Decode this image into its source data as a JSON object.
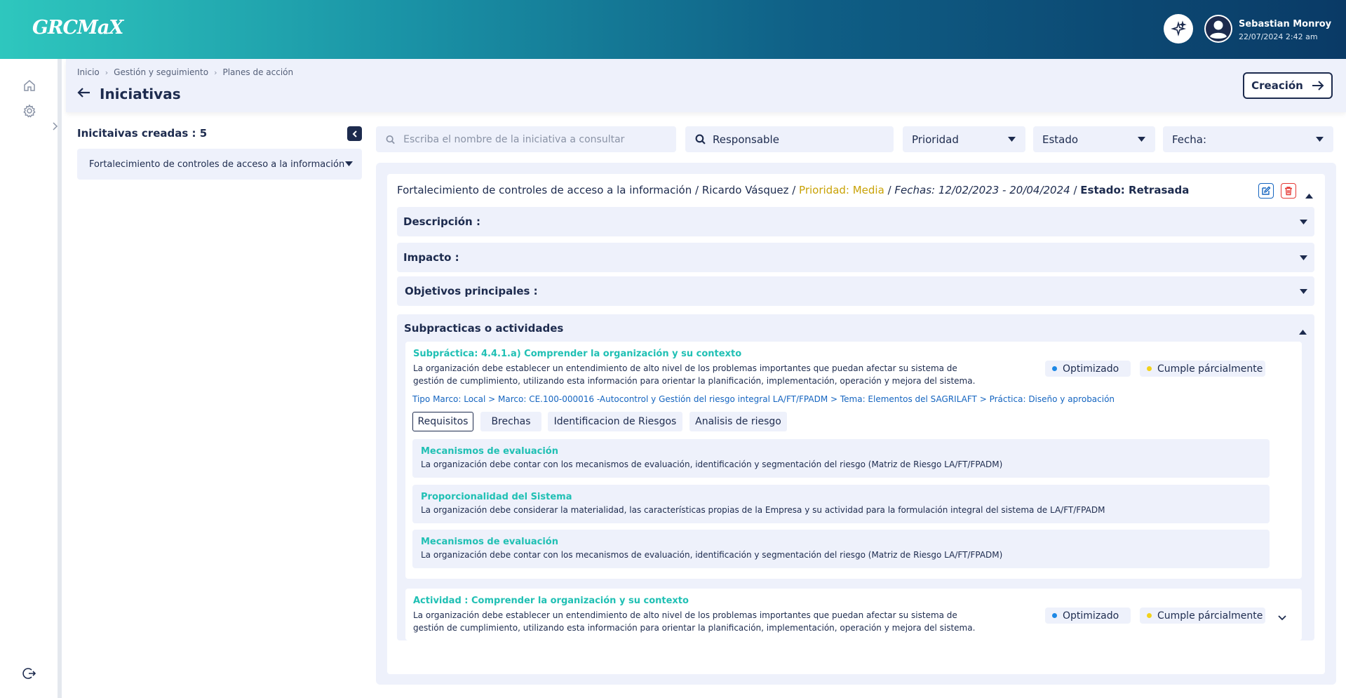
{
  "app": {
    "logo": "GRCMaX"
  },
  "user": {
    "name": "Sebastian Monroy",
    "datetime": "22/07/2024 2:42 am"
  },
  "breadcrumb": [
    "Inicio",
    "Gestión y seguimiento",
    "Planes de acción"
  ],
  "page": {
    "title": "Iniciativas",
    "create_label": "Creación"
  },
  "left_panel": {
    "title": "Inicitaivas creadas : 5",
    "items": [
      {
        "label": "Fortalecimiento de controles de acceso a la información"
      }
    ]
  },
  "filters": {
    "search_placeholder": "Escriba el nombre de la iniciativa a consultar",
    "responsable": "Responsable",
    "prioridad": "Prioridad",
    "estado": "Estado",
    "fecha": "Fecha:"
  },
  "initiative": {
    "name": "Fortalecimiento de controles de acceso a la información",
    "sep1": " / ",
    "owner": "Ricardo Vásquez",
    "sep2": " / ",
    "priority": "Prioridad: Media",
    "sep3": " / ",
    "dates": "Fechas: 12/02/2023 - 20/04/2024",
    "sep4": " / ",
    "status": "Estado: Retrasada"
  },
  "sections": {
    "descripcion": "Descripción :",
    "impacto": "Impacto :",
    "objetivos": "Objetivos principales :",
    "subpracticas": "Subpracticas o actividades"
  },
  "subpractica": {
    "title": "Subpráctica: 4.4.1.a) Comprender la organización y su contexto",
    "desc_line1": "La organización debe establecer un entendimiento de alto nivel de los problemas importantes que puedan afectar su sistema de",
    "desc_line2": "gestión de cumplimiento, utilizando esta información para orientar la planificación, implementación, operación y mejora del sistema.",
    "badge_optimizado": "Optimizado",
    "badge_cumple": "Cumple párcialmente",
    "path": "Tipo Marco: Local > Marco: CE.100-000016 -Autocontrol y Gestión del riesgo integral LA/FT/FPADM > Tema: Elementos del SAGRILAFT > Práctica: Diseño y aprobación",
    "tabs": [
      "Requisitos",
      "Brechas",
      "Identificacion de Riesgos",
      "Analisis de riesgo"
    ],
    "requirements": [
      {
        "title": "Mecanismos de evaluación",
        "desc": "La organización debe contar con los mecanismos de evaluación, identificación y segmentación del riesgo (Matriz de Riesgo LA/FT/FPADM)"
      },
      {
        "title": "Proporcionalidad del Sistema",
        "desc": "La organización debe considerar la materialidad, las características propias de la Empresa y su actividad para la formulación integral del sistema de LA/FT/FPADM"
      },
      {
        "title": "Mecanismos de evaluación",
        "desc": "La organización debe contar con los mecanismos de evaluación, identificación y segmentación del riesgo (Matriz de Riesgo LA/FT/FPADM)"
      }
    ]
  },
  "actividad": {
    "title": "Actividad :  Comprender la organización y su contexto",
    "desc_line1": "La organización debe establecer un entendimiento de alto nivel de los problemas importantes que puedan afectar su sistema de",
    "desc_line2": "gestión de cumplimiento, utilizando esta información para orientar la planificación, implementación, operación y mejora del sistema.",
    "badge_optimizado": "Optimizado",
    "badge_cumple": "Cumple párcialmente"
  },
  "colors": {
    "primary": "#1d2b4e",
    "teal": "#20c0b4",
    "priority": "#c9a206",
    "optimizado_dot": "#1e88e5",
    "cumple_dot": "#f2d21b",
    "delete": "#e53935",
    "edit": "#1565c0"
  },
  "icons": [
    "ai-sparkle-icon",
    "user-avatar-icon",
    "home-icon",
    "gear-icon",
    "logout-icon",
    "back-arrow-icon",
    "arrow-right-icon",
    "search-icon",
    "caret-down-icon",
    "edit-icon",
    "trash-icon",
    "chevron-left-icon",
    "chevron-right-icon"
  ]
}
